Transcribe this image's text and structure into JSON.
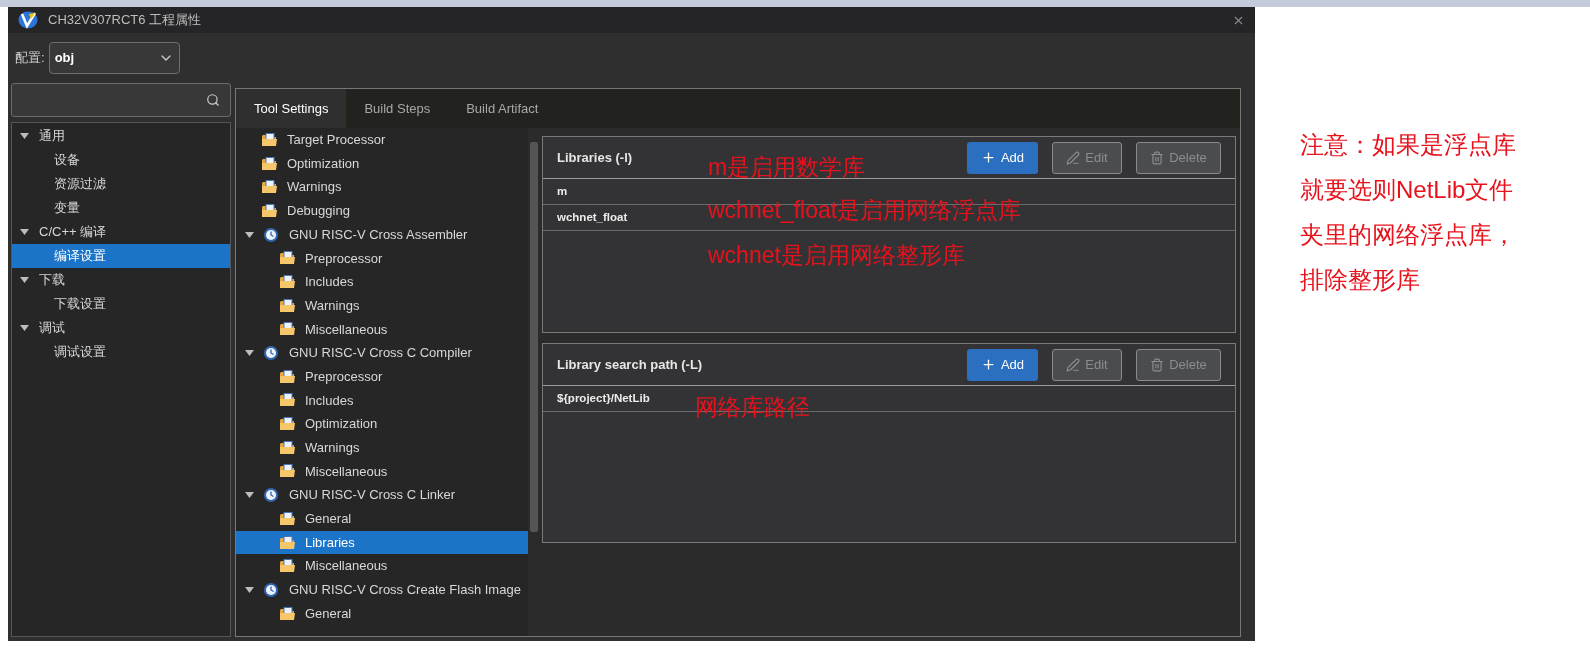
{
  "window": {
    "title": "CH32V307RCT6 工程属性"
  },
  "config": {
    "label": "配置:",
    "value": "obj"
  },
  "nav_tree": [
    {
      "label": "通用",
      "expanded": true,
      "selected": false,
      "children": [
        {
          "label": "设备",
          "selected": false
        },
        {
          "label": "资源过滤",
          "selected": false
        },
        {
          "label": "变量",
          "selected": false
        }
      ]
    },
    {
      "label": "C/C++ 编译",
      "expanded": true,
      "selected": false,
      "children": [
        {
          "label": "编译设置",
          "selected": true
        }
      ]
    },
    {
      "label": "下载",
      "expanded": true,
      "selected": false,
      "children": [
        {
          "label": "下载设置",
          "selected": false
        }
      ]
    },
    {
      "label": "调试",
      "expanded": true,
      "selected": false,
      "children": [
        {
          "label": "调试设置",
          "selected": false
        }
      ]
    }
  ],
  "tabs": [
    {
      "label": "Tool Settings",
      "selected": true
    },
    {
      "label": "Build Steps",
      "selected": false
    },
    {
      "label": "Build Artifact",
      "selected": false
    }
  ],
  "tool_tree": [
    {
      "kind": "page",
      "label": "Target Processor",
      "selected": false
    },
    {
      "kind": "page",
      "label": "Optimization",
      "selected": false
    },
    {
      "kind": "page",
      "label": "Warnings",
      "selected": false
    },
    {
      "kind": "page",
      "label": "Debugging",
      "selected": false
    },
    {
      "kind": "tool",
      "label": "GNU RISC-V Cross Assembler",
      "expanded": true,
      "selected": false,
      "children": [
        {
          "kind": "page",
          "label": "Preprocessor",
          "selected": false
        },
        {
          "kind": "page",
          "label": "Includes",
          "selected": false
        },
        {
          "kind": "page",
          "label": "Warnings",
          "selected": false
        },
        {
          "kind": "page",
          "label": "Miscellaneous",
          "selected": false
        }
      ]
    },
    {
      "kind": "tool",
      "label": "GNU RISC-V Cross C Compiler",
      "expanded": true,
      "selected": false,
      "children": [
        {
          "kind": "page",
          "label": "Preprocessor",
          "selected": false
        },
        {
          "kind": "page",
          "label": "Includes",
          "selected": false
        },
        {
          "kind": "page",
          "label": "Optimization",
          "selected": false
        },
        {
          "kind": "page",
          "label": "Warnings",
          "selected": false
        },
        {
          "kind": "page",
          "label": "Miscellaneous",
          "selected": false
        }
      ]
    },
    {
      "kind": "tool",
      "label": "GNU RISC-V Cross C Linker",
      "expanded": true,
      "selected": false,
      "children": [
        {
          "kind": "page",
          "label": "General",
          "selected": false
        },
        {
          "kind": "page",
          "label": "Libraries",
          "selected": true
        },
        {
          "kind": "page",
          "label": "Miscellaneous",
          "selected": false
        }
      ]
    },
    {
      "kind": "tool",
      "label": "GNU RISC-V Cross Create Flash Image",
      "expanded": true,
      "selected": false,
      "children": [
        {
          "kind": "page",
          "label": "General",
          "selected": false
        }
      ]
    }
  ],
  "sections": [
    {
      "title": "Libraries (-l)",
      "buttons": [
        {
          "kind": "add",
          "label": "Add",
          "disabled": false
        },
        {
          "kind": "edit",
          "label": "Edit",
          "disabled": true
        },
        {
          "kind": "delete",
          "label": "Delete",
          "disabled": true
        }
      ],
      "items": [
        "m",
        "wchnet_float"
      ]
    },
    {
      "title": "Library search path (-L)",
      "buttons": [
        {
          "kind": "add",
          "label": "Add",
          "disabled": false
        },
        {
          "kind": "edit",
          "label": "Edit",
          "disabled": true
        },
        {
          "kind": "delete",
          "label": "Delete",
          "disabled": true
        }
      ],
      "items": [
        "${project}/NetLib"
      ]
    }
  ],
  "annotations": [
    "m是启用数学库",
    "wchnet_float是启用网络浮点库",
    "wchnet是启用网络整形库",
    "网络库路径"
  ],
  "note": [
    "注意：如果是浮点库",
    "就要选则NetLib文件",
    "夹里的网络浮点库，",
    "排除整形库"
  ]
}
